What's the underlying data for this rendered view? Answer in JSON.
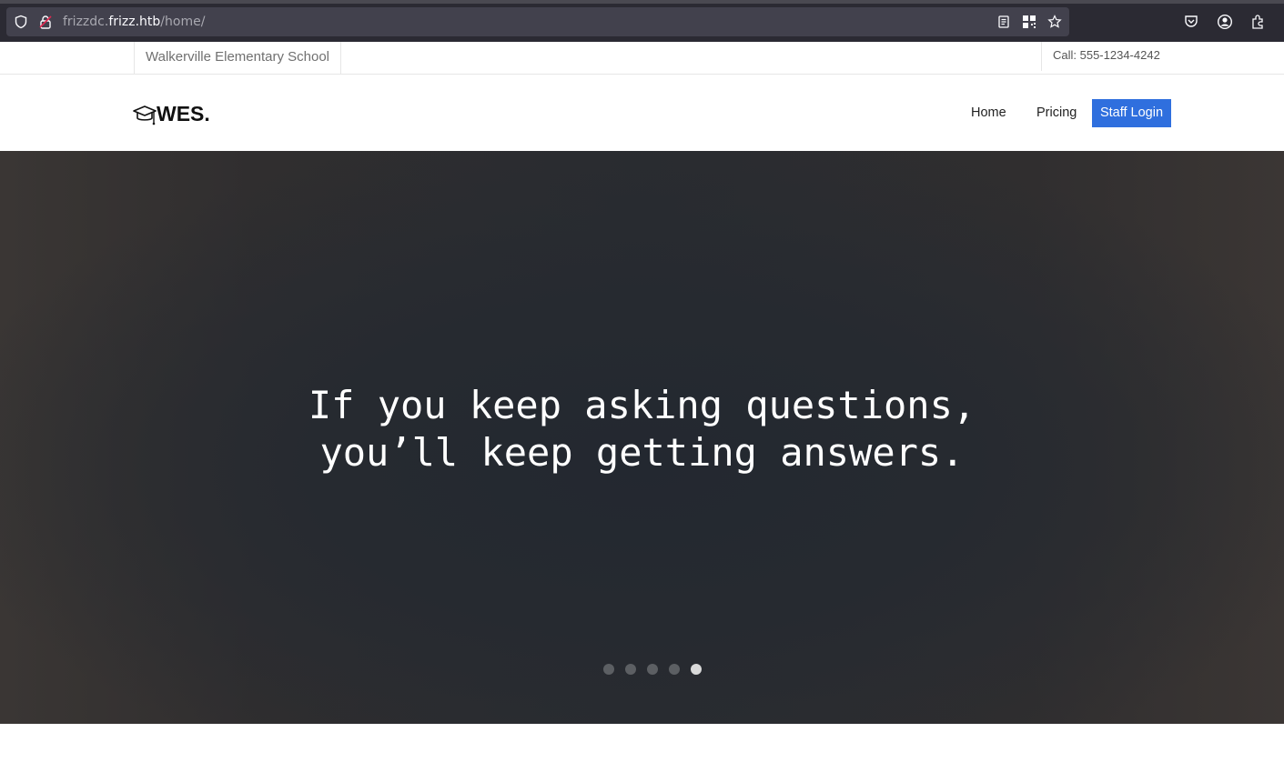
{
  "browser": {
    "url_host_prefix": "frizzdc.",
    "url_host_main": "frizz.htb",
    "url_path": "/home/"
  },
  "topbar": {
    "school_name": "Walkerville Elementary School",
    "phone": "Call: 555-1234-4242"
  },
  "navbar": {
    "logo_text": "WES.",
    "links": [
      {
        "label": "Home"
      },
      {
        "label": "Pricing"
      }
    ],
    "cta_label": "Staff Login"
  },
  "hero": {
    "quote_line1": "If you keep asking questions,",
    "quote_line2": "you’ll keep getting answers.",
    "slides_total": 5,
    "active_slide": 5
  },
  "colors": {
    "accent": "#2f6fde",
    "hero_bg": "#2a2c30",
    "browser_chrome": "#2b2a33"
  }
}
